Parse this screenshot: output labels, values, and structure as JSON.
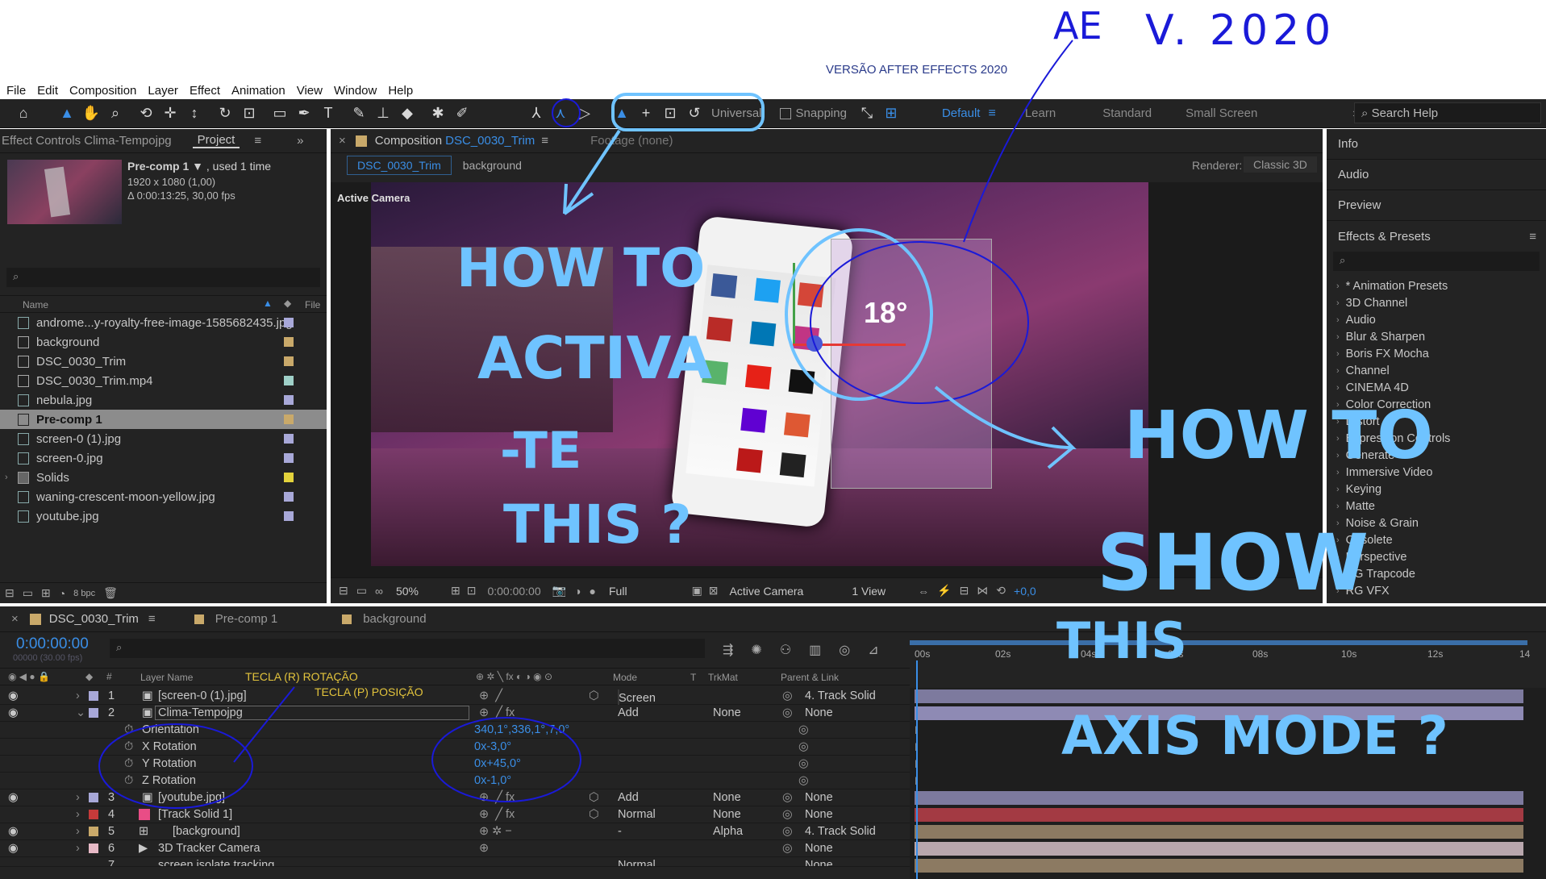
{
  "overlay_note": "VERSÃO AFTER EFFECTS 2020",
  "handwriting": {
    "ae": "AE",
    "v2020": "V. 2020",
    "how_activate": [
      "HOW TO",
      "ACTIVA",
      "-TE",
      "THIS ?"
    ],
    "how_show": [
      "HOW TO",
      "SHOW",
      "THIS",
      "AXIS MODE ?"
    ]
  },
  "menu": [
    "File",
    "Edit",
    "Composition",
    "Layer",
    "Effect",
    "Animation",
    "View",
    "Window",
    "Help"
  ],
  "toolbar": {
    "axis_mode": "Universal",
    "snapping": "Snapping",
    "workspaces": [
      "Default",
      "Learn",
      "Standard",
      "Small Screen"
    ],
    "search_placeholder": "Search Help"
  },
  "project_panel": {
    "tab_effect_controls": "Effect Controls Clima-Tempojpg",
    "tab_project": "Project",
    "selected_name": "Pre-comp 1",
    "used": ", used 1 time",
    "dims": "1920 x 1080 (1,00)",
    "duration": "Δ 0:00:13:25, 30,00 fps",
    "col_name": "Name",
    "col_file": "File",
    "bpc": "8 bpc",
    "items": [
      {
        "name": "androme...y-royalty-free-image-1585682435.jpg",
        "color": "#a8a8d8"
      },
      {
        "name": "background",
        "color": "#c9a96a"
      },
      {
        "name": "DSC_0030_Trim",
        "color": "#c9a96a"
      },
      {
        "name": "DSC_0030_Trim.mp4",
        "color": "#9fd0c8"
      },
      {
        "name": "nebula.jpg",
        "color": "#a8a8d8"
      },
      {
        "name": "Pre-comp 1",
        "color": "#c9a96a"
      },
      {
        "name": "screen-0 (1).jpg",
        "color": "#a8a8d8"
      },
      {
        "name": "screen-0.jpg",
        "color": "#a8a8d8"
      },
      {
        "name": "Solids",
        "color": "#e3d23c"
      },
      {
        "name": "waning-crescent-moon-yellow.jpg",
        "color": "#a8a8d8"
      },
      {
        "name": "youtube.jpg",
        "color": "#a8a8d8"
      }
    ]
  },
  "composition": {
    "tab_label": "Composition",
    "comp_name": "DSC_0030_Trim",
    "footage_label": "Footage",
    "footage_value": "(none)",
    "sub_tabs": [
      "DSC_0030_Trim",
      "background"
    ],
    "renderer_label": "Renderer:",
    "renderer_value": "Classic 3D",
    "view_label": "Active Camera",
    "footer": {
      "zoom": "50%",
      "timecode": "0:00:00:00",
      "resolution": "Full",
      "camera": "Active Camera",
      "views": "1 View",
      "offset": "+0,0"
    },
    "phone_weather_temp": "18°"
  },
  "right_panel": {
    "items": [
      "Info",
      "Audio",
      "Preview"
    ],
    "effects_title": "Effects & Presets",
    "effects": [
      "* Animation Presets",
      "3D Channel",
      "Audio",
      "Blur & Sharpen",
      "Boris FX Mocha",
      "Channel",
      "CINEMA 4D",
      "Color Correction",
      "Distort",
      "Expression Controls",
      "Generate",
      "Immersive Video",
      "Keying",
      "Matte",
      "Noise & Grain",
      "Obsolete",
      "Perspective",
      "RG Trapcode",
      "RG VFX"
    ]
  },
  "timeline": {
    "tabs": [
      "DSC_0030_Trim",
      "Pre-comp 1",
      "background"
    ],
    "timecode": "0:00:00:00",
    "frames": "00000 (30.00 fps)",
    "col_layer": "Layer Name",
    "col_mode": "Mode",
    "col_t": "T",
    "col_trkmat": "TrkMat",
    "col_parent": "Parent & Link",
    "note_r": "TECLA (R)  ROTAÇÃO",
    "note_p": "TECLA  (P)  POSIÇÃO",
    "ruler": [
      "00s",
      "02s",
      "04s",
      "06s",
      "08s",
      "10s",
      "12s",
      "14"
    ],
    "layers": [
      {
        "num": "1",
        "name": "[screen-0 (1).jpg]",
        "color": "#a8a8d8",
        "mode": "Screen",
        "trkmat": "",
        "parent": "4. Track Solid",
        "bar": "#7d7a9e"
      },
      {
        "num": "2",
        "name": "Clima-Tempojpg",
        "color": "#a8a8d8",
        "mode": "Add",
        "trkmat": "None",
        "parent": "None",
        "bar": "#7d7a9e"
      },
      {
        "num": "3",
        "name": "[youtube.jpg]",
        "color": "#a8a8d8",
        "mode": "Add",
        "trkmat": "None",
        "parent": "None",
        "bar": "#7d7a9e"
      },
      {
        "num": "4",
        "name": "[Track Solid 1]",
        "color": "#c63a3a",
        "mode": "Normal",
        "trkmat": "None",
        "parent": "None",
        "bar": "#a33a43"
      },
      {
        "num": "5",
        "name": "[background]",
        "color": "#c9a96a",
        "mode": "-",
        "trkmat": "Alpha",
        "parent": "4. Track Solid",
        "bar": "#8c7a62"
      },
      {
        "num": "6",
        "name": "3D Tracker Camera",
        "color": "#e7b9c6",
        "mode": "",
        "trkmat": "",
        "parent": "None",
        "bar": "#b9a7ad"
      },
      {
        "num": "7",
        "name": "screen isolate tracking",
        "color": "#c9a96a",
        "mode": "Normal",
        "trkmat": "",
        "parent": "None",
        "bar": "#8c7a62"
      }
    ],
    "props": [
      {
        "name": "Orientation",
        "value": "340,1°,336,1°,7,0°"
      },
      {
        "name": "X Rotation",
        "value": "0x-3,0°"
      },
      {
        "name": "Y Rotation",
        "value": "0x+45,0°"
      },
      {
        "name": "Z Rotation",
        "value": "0x-1,0°"
      }
    ]
  },
  "colors": {
    "accent": "#3a8ee6",
    "panel": "#232323",
    "annotation_light": "#6fc3ff",
    "annotation_dark": "#1a1ad8"
  }
}
